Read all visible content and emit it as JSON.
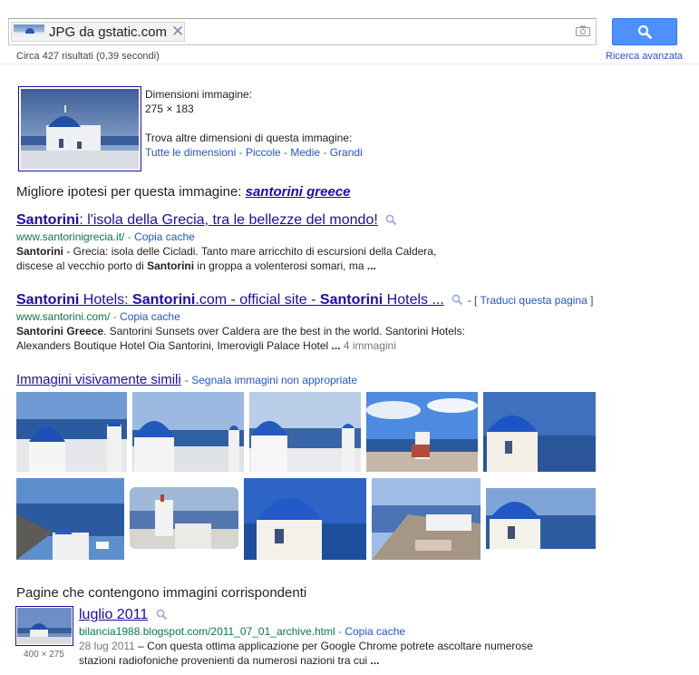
{
  "search": {
    "chip_label": "JPG da gstatic.com",
    "stats": "Circa 427 risultati (0,39 secondi)",
    "advanced": "Ricerca avanzata"
  },
  "image_info": {
    "dims_label": "Dimensioni immagine:",
    "dims_value": "275 × 183",
    "other_sizes_label": "Trova altre dimensioni di questa immagine:",
    "sizes": [
      "Tutte le dimensioni",
      "Piccole",
      "Medie",
      "Grandi"
    ]
  },
  "best_guess": {
    "label": "Migliore ipotesi per questa immagine:",
    "query": "santorini greece"
  },
  "results": [
    {
      "title_bold": "Santorini",
      "title_rest": ": l'isola della Grecia, tra le bellezze del mondo!",
      "url": "www.santorinigrecia.it/",
      "cache": "Copia cache",
      "snippet_line1_bold": "Santorini",
      "snippet_line1": " - Grecia: isola delle Cicladi. Tanto mare arricchito di escursioni della Caldera,",
      "snippet_line2_a": "discese al vecchio porto di ",
      "snippet_line2_bold": "Santorini",
      "snippet_line2_b": " in groppa a volenterosi somari, ma ",
      "ellipsis": "..."
    },
    {
      "title_p1": "Santorini",
      "title_p2": " Hotels: ",
      "title_p3": "Santorini",
      "title_p4": ".com - official site - ",
      "title_p5": "Santorini",
      "title_p6": " Hotels ...",
      "translate": "Traduci questa pagina",
      "url": "www.santorini.com/",
      "cache": "Copia cache",
      "snippet_line1_bold": "Santorini Greece",
      "snippet_line1": ". Santorini Sunsets over Caldera are the best in the world. Santorini Hotels:",
      "snippet_line2": "Alexanders Boutique Hotel Oia Santorini, Imerovigli Palace Hotel ",
      "ellipsis": "...",
      "images": "4 immagini"
    }
  ],
  "similar": {
    "title": "Immagini visivamente simili",
    "report": "Segnala immagini non appropriate"
  },
  "pages": {
    "title": "Pagine che contengono immagini corrispondenti",
    "item_title": "luglio 2011",
    "item_url": "bilancia1988.blogspot.com/2011_07_01_archive.html",
    "item_cache": "Copia cache",
    "item_date": "28 lug 2011",
    "item_snippet1": " – Con questa ottima applicazione per Google Chrome potrete ascoltare numerose",
    "item_snippet2": "stazioni radiofoniche provenienti da numerosi nazioni tra cui ",
    "item_ellipsis": "...",
    "thumb_dims": "400 × 275"
  },
  "colors": {
    "link": "#1a0dab",
    "url_green": "#0e774a",
    "search_button": "#4d90fe"
  }
}
